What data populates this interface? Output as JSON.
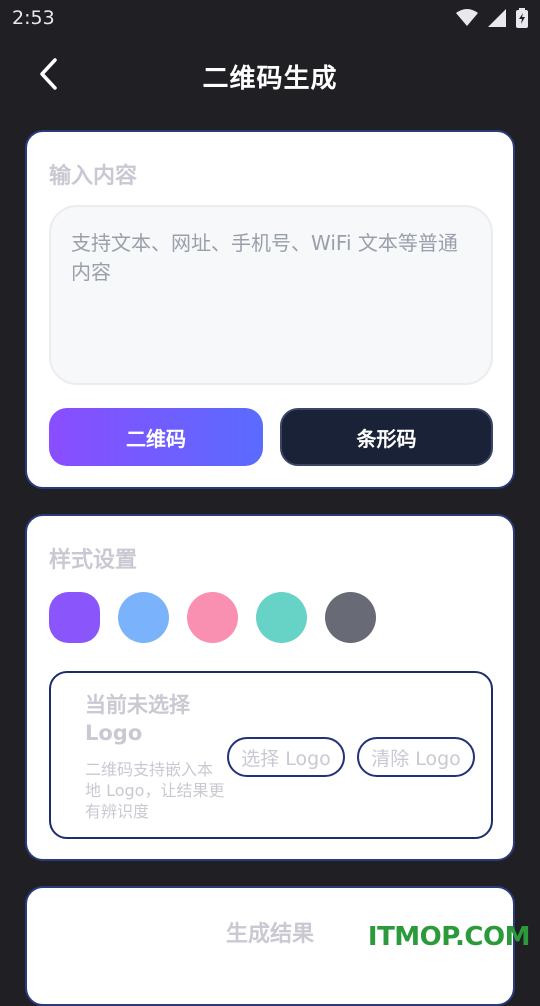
{
  "status": {
    "time": "2:53"
  },
  "header": {
    "title": "二维码生成"
  },
  "input_card": {
    "title": "输入内容",
    "placeholder": "支持文本、网址、手机号、WiFi 文本等普通内容",
    "qr_button": "二维码",
    "barcode_button": "条形码"
  },
  "style_card": {
    "title": "样式设置",
    "swatches": [
      "#8a55fb",
      "#7ab3fb",
      "#f98fb1",
      "#67d3c6",
      "#686b75"
    ],
    "logo": {
      "status": "当前未选择 Logo",
      "description": "二维码支持嵌入本地 Logo，让结果更有辨识度",
      "select_button": "选择 Logo",
      "clear_button": "清除 Logo"
    }
  },
  "result_card": {
    "title": "生成结果"
  },
  "watermark": "ITMOP.COM"
}
